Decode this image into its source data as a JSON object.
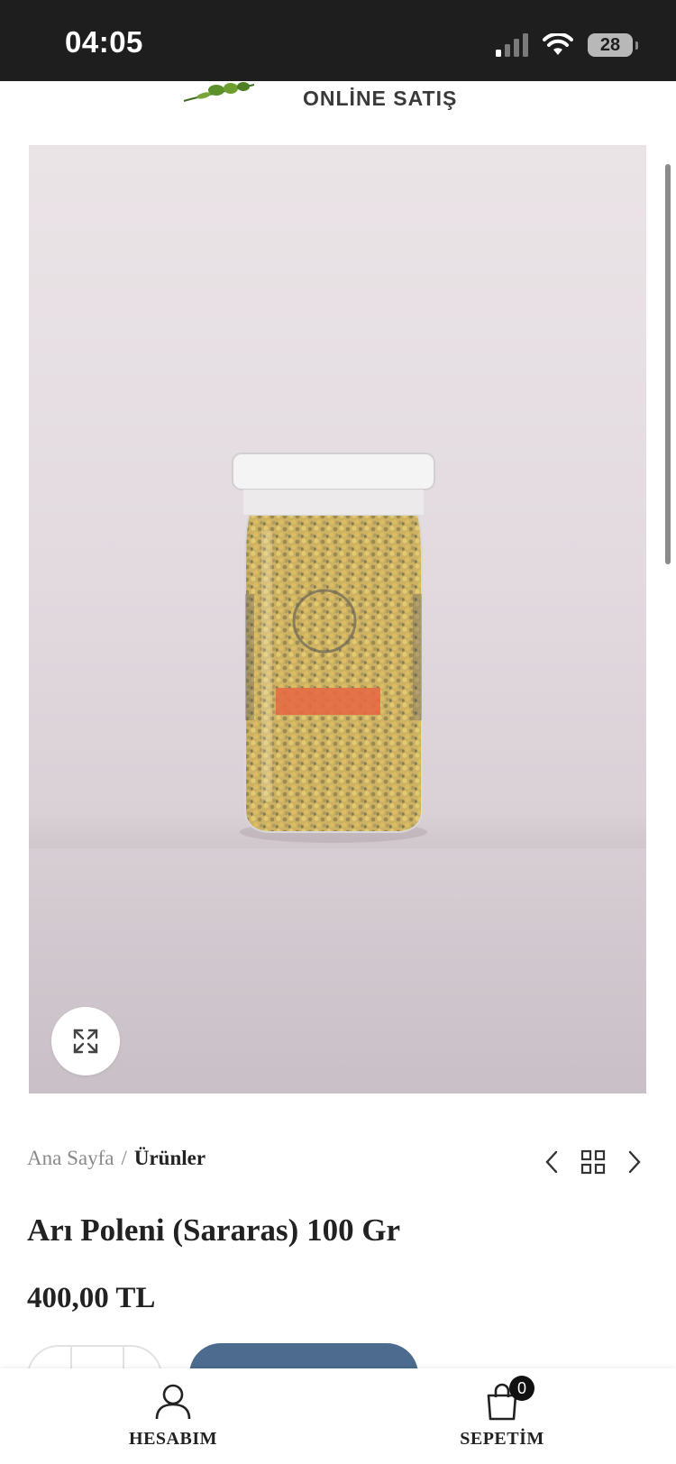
{
  "status_bar": {
    "time": "04:05",
    "battery_level": "28"
  },
  "header": {
    "logo_text": "ONLİNE SATIŞ"
  },
  "product": {
    "image_alt": "Arı Poleni jar",
    "zoom_icon": "expand-icon",
    "title": "Arı Poleni (Sararas) 100 Gr",
    "price": "400,00 TL"
  },
  "breadcrumb": {
    "home": "Ana Sayfa",
    "separator": "/",
    "current": "Ürünler"
  },
  "product_nav": {
    "prev_icon": "chevron-left-icon",
    "grid_icon": "grid-icon",
    "next_icon": "chevron-right-icon"
  },
  "bottom_bar": {
    "account_label": "HESABIM",
    "cart_label": "SEPETİM",
    "cart_count": "0"
  },
  "colors": {
    "accent": "#4c6b8e",
    "status_bar_bg": "#1e1e1e",
    "text": "#222222"
  }
}
